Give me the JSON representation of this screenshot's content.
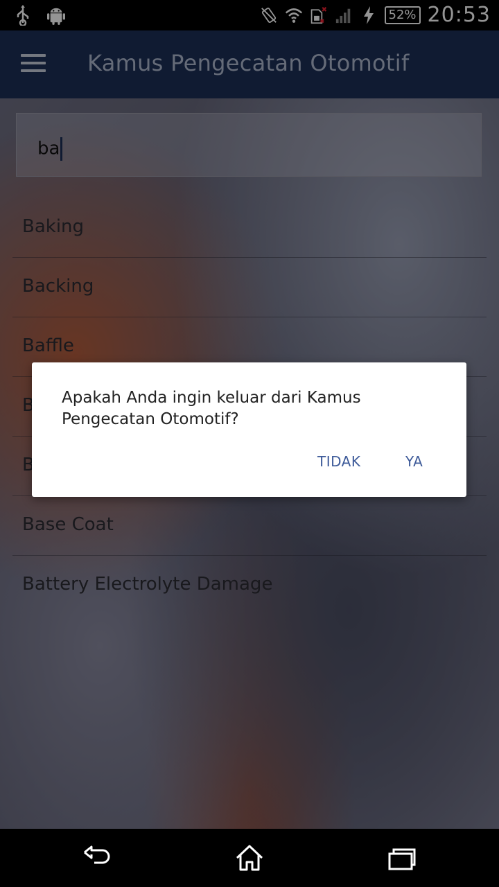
{
  "status_bar": {
    "icons_left": [
      "usb-icon",
      "android-icon"
    ],
    "icons_right": [
      "vibrate-icon",
      "wifi-icon",
      "sim-error-icon",
      "signal-icon",
      "charging-icon"
    ],
    "battery": "52%",
    "time": "20:53"
  },
  "app_bar": {
    "title": "Kamus Pengecatan Otomotif",
    "color": "#1d2f57"
  },
  "search": {
    "value": "ba"
  },
  "list": {
    "items": [
      {
        "label": "Baking"
      },
      {
        "label": "Backing"
      },
      {
        "label": "Baffle"
      },
      {
        "label": "B"
      },
      {
        "label": "B"
      },
      {
        "label": "Base Coat"
      },
      {
        "label": "Battery Electrolyte Damage"
      }
    ]
  },
  "dialog": {
    "message": "Apakah Anda ingin keluar dari Kamus Pengecatan Otomotif?",
    "negative_label": "TIDAK",
    "positive_label": "YA",
    "accent": "#3d5a99"
  },
  "nav_bar": {
    "buttons": [
      "back-icon",
      "home-icon",
      "recent-apps-icon"
    ]
  }
}
